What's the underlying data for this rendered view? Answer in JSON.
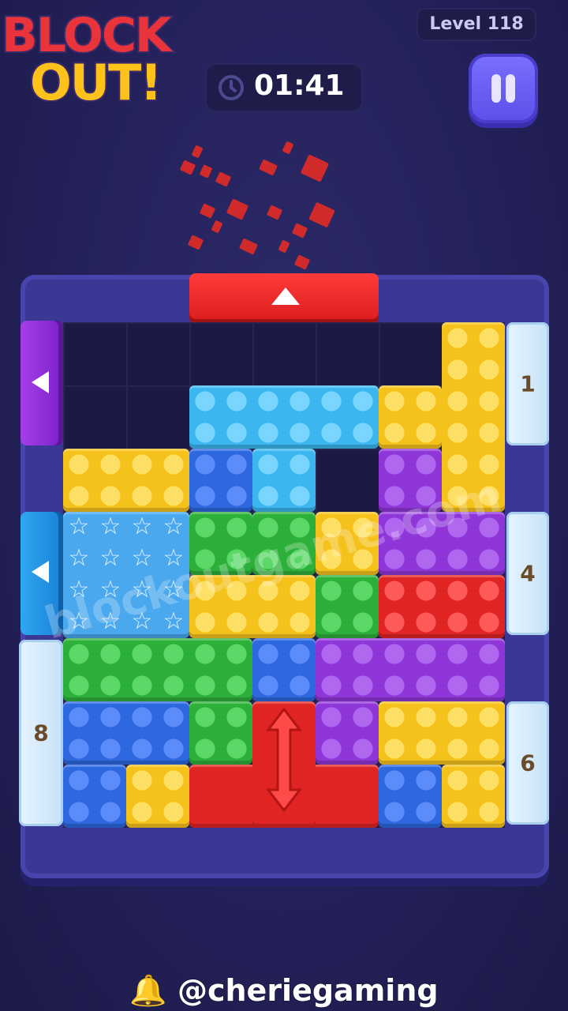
{
  "header": {
    "logo_line1": "BLOCK",
    "logo_line2": "OUT!",
    "level": "Level 118",
    "timer": "01:41"
  },
  "gates": {
    "right_top": "1",
    "right_middle": "4",
    "right_bottom": "6",
    "left_bottom": "8"
  },
  "watermark": "blockoutgame.com",
  "footer": {
    "handle": "@cheriegaming",
    "bell_icon": "bell-icon"
  },
  "colors": {
    "background": "#24215a",
    "frame": "#3a3895",
    "red": "#e02424",
    "yellow": "#f5c21c",
    "blue": "#2e68e0",
    "light_blue": "#3cb6ef",
    "green": "#2cb03a",
    "purple": "#8e36d8"
  }
}
